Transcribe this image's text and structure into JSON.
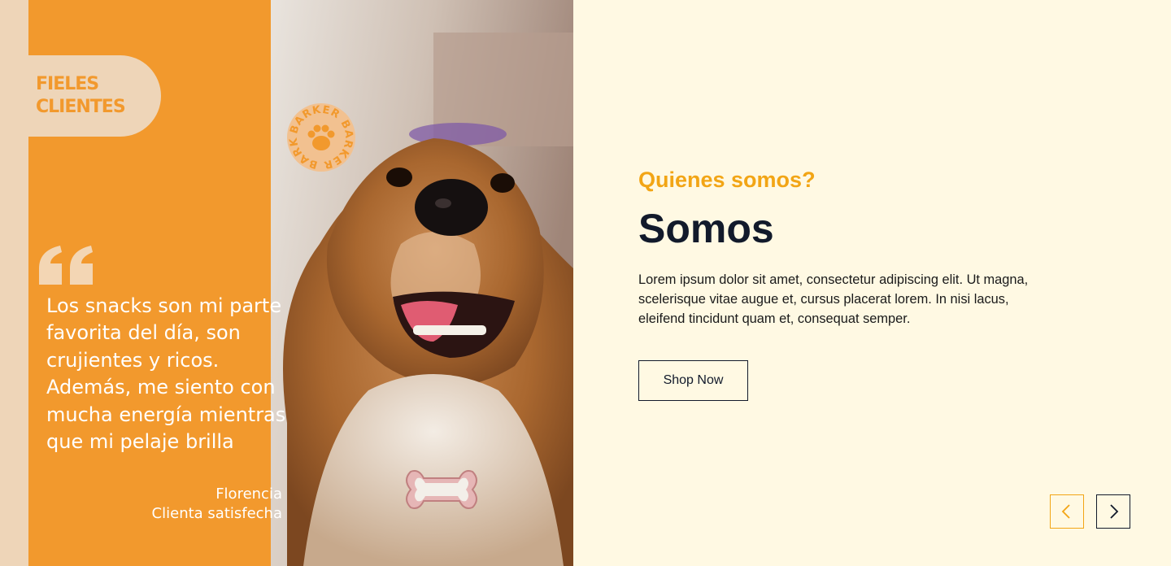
{
  "badge": {
    "line1": "FIELES",
    "line2": "CLIENTES"
  },
  "stamp": {
    "brand": "BARKER"
  },
  "testimonial": {
    "quote": "Los snacks son mi parte favorita del día, son crujientes y ricos. Además, me siento con mucha energía mientras que mi pelaje brilla",
    "author_name": "Florencia",
    "author_role": "Clienta satisfecha"
  },
  "about": {
    "eyebrow": "Quienes somos?",
    "title": "Somos",
    "body": "Lorem ipsum dolor sit amet, consectetur adipiscing elit. Ut magna, scelerisque vitae augue et, cursus placerat lorem. In nisi lacus, eleifend tincidunt quam et, consequat semper.",
    "cta_label": "Shop Now"
  },
  "icons": {
    "prev": "chevron-left-icon",
    "next": "chevron-right-icon",
    "quote": "quote-icon",
    "paw": "paw-icon"
  },
  "colors": {
    "orange": "#f2992d",
    "beige": "#eed5b8",
    "cream": "#fff9e3",
    "accent": "#f2a515",
    "dark": "#121a2b"
  }
}
